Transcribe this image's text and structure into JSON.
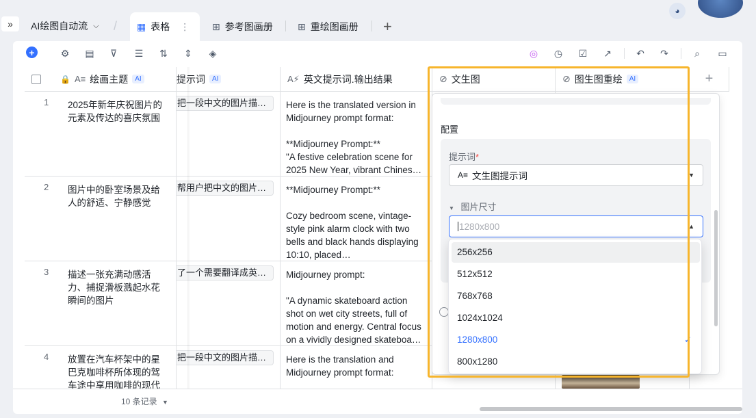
{
  "app": {
    "name": "AI绘图自动流"
  },
  "tabs": [
    {
      "label": "表格",
      "icon": "grid-icon",
      "active": true
    },
    {
      "label": "参考图画册",
      "icon": "gallery-icon",
      "active": false
    },
    {
      "label": "重绘图画册",
      "icon": "gallery-icon",
      "active": false
    }
  ],
  "columns": {
    "theme": "绘画主题",
    "prompt": "提示词",
    "english": "英文提示词.输出结果",
    "text2img": "文生图",
    "img2img": "图生图重绘",
    "ai_tag": "AI"
  },
  "rows": [
    {
      "num": "1",
      "theme": "2025年新年庆祝图片的元素及传达的喜庆氛围",
      "prompt": "把一段中文的图片描…",
      "output": "Here is the translated version in Midjourney prompt format:\n\n**Midjourney Prompt:**\n\"A festive celebration scene for 2025 New Year, vibrant Chines…"
    },
    {
      "num": "2",
      "theme": "图片中的卧室场景及给人的舒适、宁静感觉",
      "prompt": "帮用户把中文的图片…",
      "output": "**Midjourney Prompt:**\n\nCozy bedroom scene, vintage-style pink alarm clock with two bells and black hands displaying 10:10, placed…"
    },
    {
      "num": "3",
      "theme": "描述一张充满动感活力、捕捉滑板溅起水花瞬间的图片",
      "prompt": "了一个需要翻译成英…",
      "output": "Midjourney prompt:\n\n\"A dynamic skateboard action shot on wet city streets, full of motion and energy. Central focus on a vividly designed skateboa…"
    },
    {
      "num": "4",
      "theme": "放置在汽车杯架中的星巴克咖啡杯所体现的驾车途中享用咖啡的现代",
      "prompt": "把一段中文的图片描…",
      "output": "Here is the translation and Midjourney prompt format:"
    }
  ],
  "footer": {
    "record_count": "10 条记录"
  },
  "config": {
    "title": "配置",
    "prompt_label": "提示词",
    "prompt_value": "文生图提示词",
    "size_label": "图片尺寸",
    "size_placeholder": "1280x800"
  },
  "size_options": [
    {
      "label": "256x256",
      "hover": true,
      "selected": false
    },
    {
      "label": "512x512",
      "hover": false,
      "selected": false
    },
    {
      "label": "768x768",
      "hover": false,
      "selected": false
    },
    {
      "label": "1024x1024",
      "hover": false,
      "selected": false
    },
    {
      "label": "1280x800",
      "hover": false,
      "selected": true
    },
    {
      "label": "800x1280",
      "hover": false,
      "selected": false
    }
  ],
  "colors": {
    "accent": "#3370ff",
    "highlight": "#f7b52c"
  }
}
